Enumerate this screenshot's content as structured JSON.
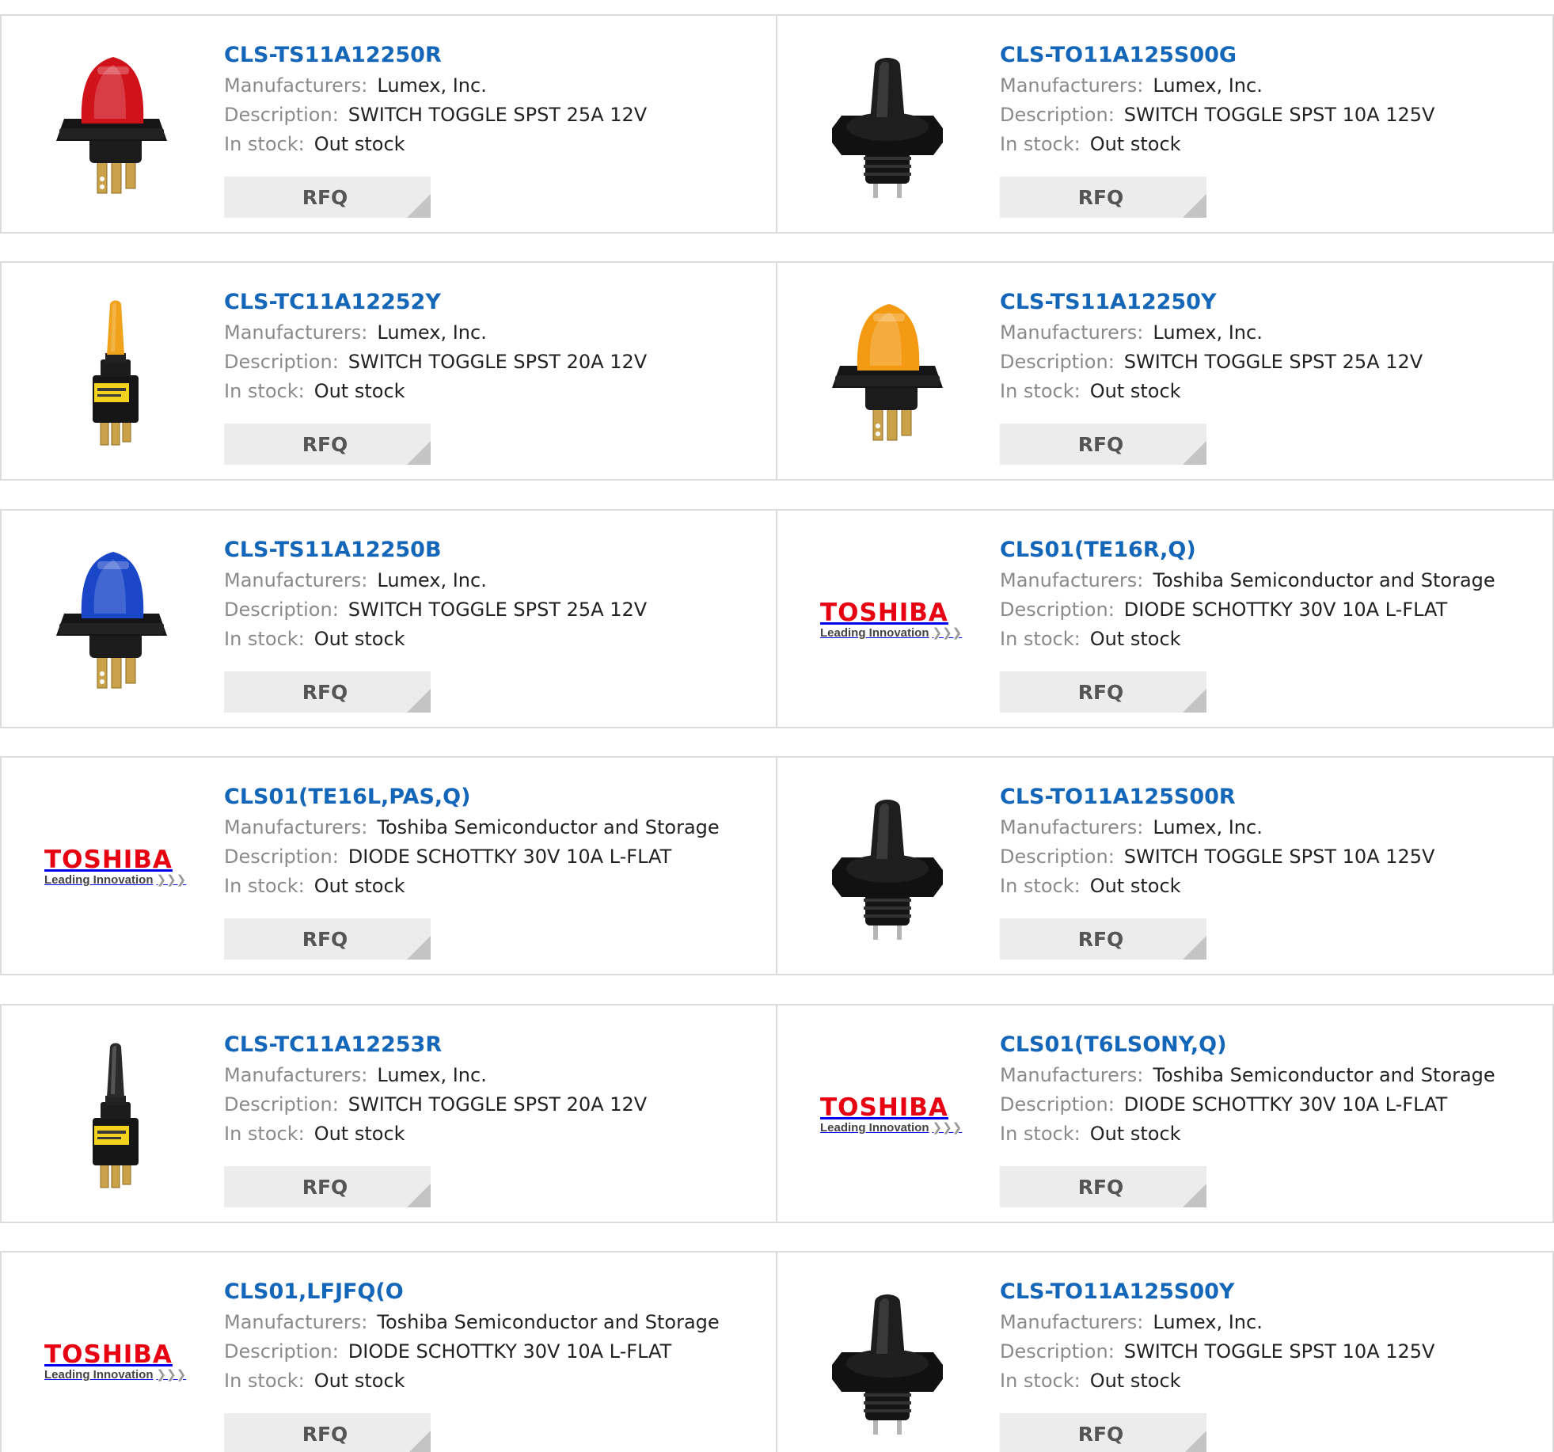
{
  "labels": {
    "manufacturers": "Manufacturers:",
    "description": "Description:",
    "stock": "In stock:",
    "rfq": "RFQ"
  },
  "logo_text": {
    "brand": "TOSHIBA",
    "tagline": "Leading Innovation",
    "arrows": "❯❯❯"
  },
  "colors": {
    "part_link": "#1466b8",
    "toshiba_red": "#e60012",
    "rfq_bg": "#ececec"
  },
  "products": [
    {
      "part": "CLS-TS11A12250R",
      "manufacturer": "Lumex, Inc.",
      "description": "SWITCH TOGGLE SPST 25A 12V",
      "stock": "Out stock",
      "image": "rocker-switch-red-icon",
      "image_color": "#d0121b"
    },
    {
      "part": "CLS-TO11A125S00G",
      "manufacturer": "Lumex, Inc.",
      "description": "SWITCH TOGGLE SPST 10A 125V",
      "stock": "Out stock",
      "image": "round-toggle-switch-icon",
      "image_color": "#1e1e1e"
    },
    {
      "part": "CLS-TC11A12252Y",
      "manufacturer": "Lumex, Inc.",
      "description": "SWITCH TOGGLE SPST 20A 12V",
      "stock": "Out stock",
      "image": "lever-toggle-switch-icon",
      "image_color": "#f0a21a"
    },
    {
      "part": "CLS-TS11A12250Y",
      "manufacturer": "Lumex, Inc.",
      "description": "SWITCH TOGGLE SPST 25A 12V",
      "stock": "Out stock",
      "image": "rocker-switch-amber-icon",
      "image_color": "#f39a12"
    },
    {
      "part": "CLS-TS11A12250B",
      "manufacturer": "Lumex, Inc.",
      "description": "SWITCH TOGGLE SPST 25A 12V",
      "stock": "Out stock",
      "image": "rocker-switch-blue-icon",
      "image_color": "#1a46c8"
    },
    {
      "part": "CLS01(TE16R,Q)",
      "manufacturer": "Toshiba Semiconductor and Storage",
      "description": "DIODE SCHOTTKY 30V 10A L-FLAT",
      "stock": "Out stock",
      "image": "toshiba-logo",
      "image_color": "#e60012"
    },
    {
      "part": "CLS01(TE16L,PAS,Q)",
      "manufacturer": "Toshiba Semiconductor and Storage",
      "description": "DIODE SCHOTTKY 30V 10A L-FLAT",
      "stock": "Out stock",
      "image": "toshiba-logo",
      "image_color": "#e60012"
    },
    {
      "part": "CLS-TO11A125S00R",
      "manufacturer": "Lumex, Inc.",
      "description": "SWITCH TOGGLE SPST 10A 125V",
      "stock": "Out stock",
      "image": "round-toggle-switch-icon",
      "image_color": "#1e1e1e"
    },
    {
      "part": "CLS-TC11A12253R",
      "manufacturer": "Lumex, Inc.",
      "description": "SWITCH TOGGLE SPST 20A 12V",
      "stock": "Out stock",
      "image": "lever-toggle-switch-icon",
      "image_color": "#2a2a2a"
    },
    {
      "part": "CLS01(T6LSONY,Q)",
      "manufacturer": "Toshiba Semiconductor and Storage",
      "description": "DIODE SCHOTTKY 30V 10A L-FLAT",
      "stock": "Out stock",
      "image": "toshiba-logo",
      "image_color": "#e60012"
    },
    {
      "part": "CLS01,LFJFQ(O",
      "manufacturer": "Toshiba Semiconductor and Storage",
      "description": "DIODE SCHOTTKY 30V 10A L-FLAT",
      "stock": "Out stock",
      "image": "toshiba-logo",
      "image_color": "#e60012"
    },
    {
      "part": "CLS-TO11A125S00Y",
      "manufacturer": "Lumex, Inc.",
      "description": "SWITCH TOGGLE SPST 10A 125V",
      "stock": "Out stock",
      "image": "round-toggle-switch-icon",
      "image_color": "#1e1e1e"
    }
  ]
}
